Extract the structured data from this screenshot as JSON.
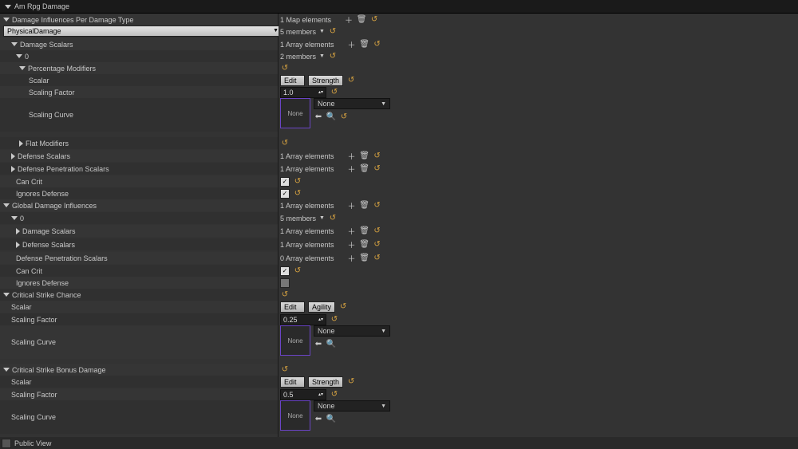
{
  "title": "Am Rpg Damage",
  "footer": {
    "public_view": "Public View"
  },
  "sections": {
    "damage_influences": "Damage Influences Per Damage Type",
    "damage_type_dd": "PhysicalDamage",
    "damage_scalars": "Damage Scalars",
    "idx0": "0",
    "percentage_modifiers": "Percentage Modifiers",
    "scalar": "Scalar",
    "scaling_factor": "Scaling Factor",
    "scaling_curve": "Scaling Curve",
    "flat_modifiers": "Flat Modifiers",
    "defense_scalars": "Defense Scalars",
    "defense_pen_scalars": "Defense Penetration Scalars",
    "can_crit": "Can Crit",
    "ignores_defense": "Ignores Defense",
    "global_damage_influences": "Global Damage Influences",
    "crit_chance": "Critical Strike Chance",
    "crit_bonus": "Critical Strike Bonus Damage"
  },
  "values": {
    "map1": "1 Map elements",
    "members5": "5 members",
    "array1": "1 Array elements",
    "members2": "2 members",
    "array0": "0 Array elements",
    "edit": "Edit",
    "strength": "Strength",
    "agility": "Agility",
    "one": "1.0",
    "quarter": "0.25",
    "half": "0.5",
    "none": "None"
  }
}
